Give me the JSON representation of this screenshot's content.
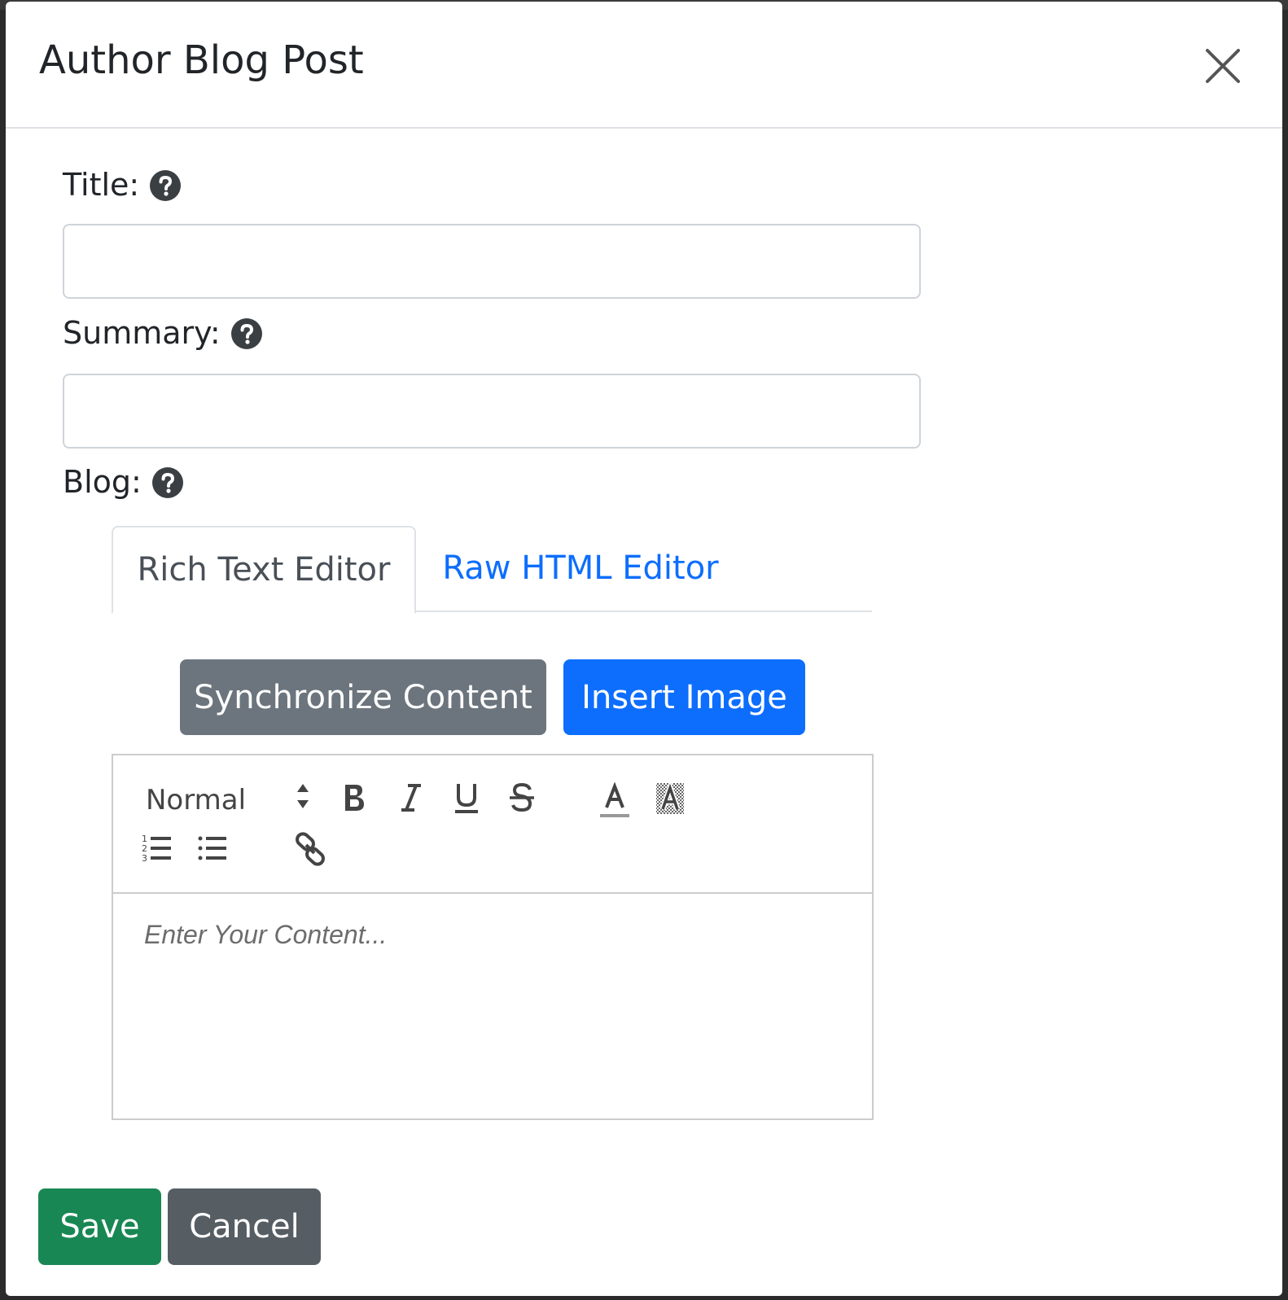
{
  "modal": {
    "title": "Author Blog Post"
  },
  "fields": {
    "title": {
      "label": "Title:",
      "value": "",
      "placeholder": ""
    },
    "summary": {
      "label": "Summary:",
      "value": "",
      "placeholder": ""
    },
    "blog": {
      "label": "Blog:"
    }
  },
  "tabs": [
    {
      "label": "Rich Text Editor",
      "active": true
    },
    {
      "label": "Raw HTML Editor",
      "active": false
    }
  ],
  "editor_actions": {
    "sync_label": "Synchronize Content",
    "insert_image_label": "Insert Image"
  },
  "editor": {
    "format_value": "Normal",
    "placeholder": "Enter Your Content...",
    "toolbar_icons": [
      "bold-icon",
      "italic-icon",
      "underline-icon",
      "strikethrough-icon",
      "text-color-icon",
      "background-color-icon",
      "ordered-list-icon",
      "bullet-list-icon",
      "link-icon"
    ]
  },
  "footer": {
    "save_label": "Save",
    "cancel_label": "Cancel"
  },
  "colors": {
    "primary": "#0d6efd",
    "secondary": "#6c757d",
    "success": "#198754",
    "dark": "#565e64"
  }
}
